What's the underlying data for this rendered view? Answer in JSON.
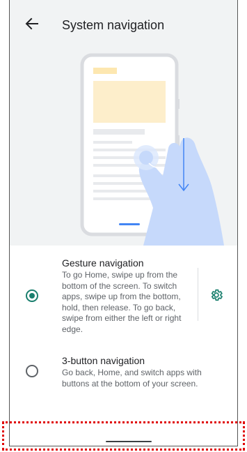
{
  "header": {
    "title": "System navigation",
    "back_icon": "arrow-back-icon"
  },
  "illustration": {
    "description_icon": "gesture-illustration"
  },
  "options": [
    {
      "title": "Gesture navigation",
      "description": "To go Home, swipe up from the bottom of the screen. To switch apps, swipe up from the bottom, hold, then release. To go back, swipe from either the left or right edge.",
      "selected": true,
      "settings_icon": "gear-icon"
    },
    {
      "title": "3-button navigation",
      "description": "Go back, Home, and switch apps with buttons at the bottom of your screen.",
      "selected": false
    }
  ],
  "colors": {
    "accent": "#1a7f6e",
    "header_bg": "#f1f3f4",
    "illustration_yellow": "#fde7b0",
    "illustration_blue": "#c6d9fb",
    "highlight": "#e00000"
  }
}
